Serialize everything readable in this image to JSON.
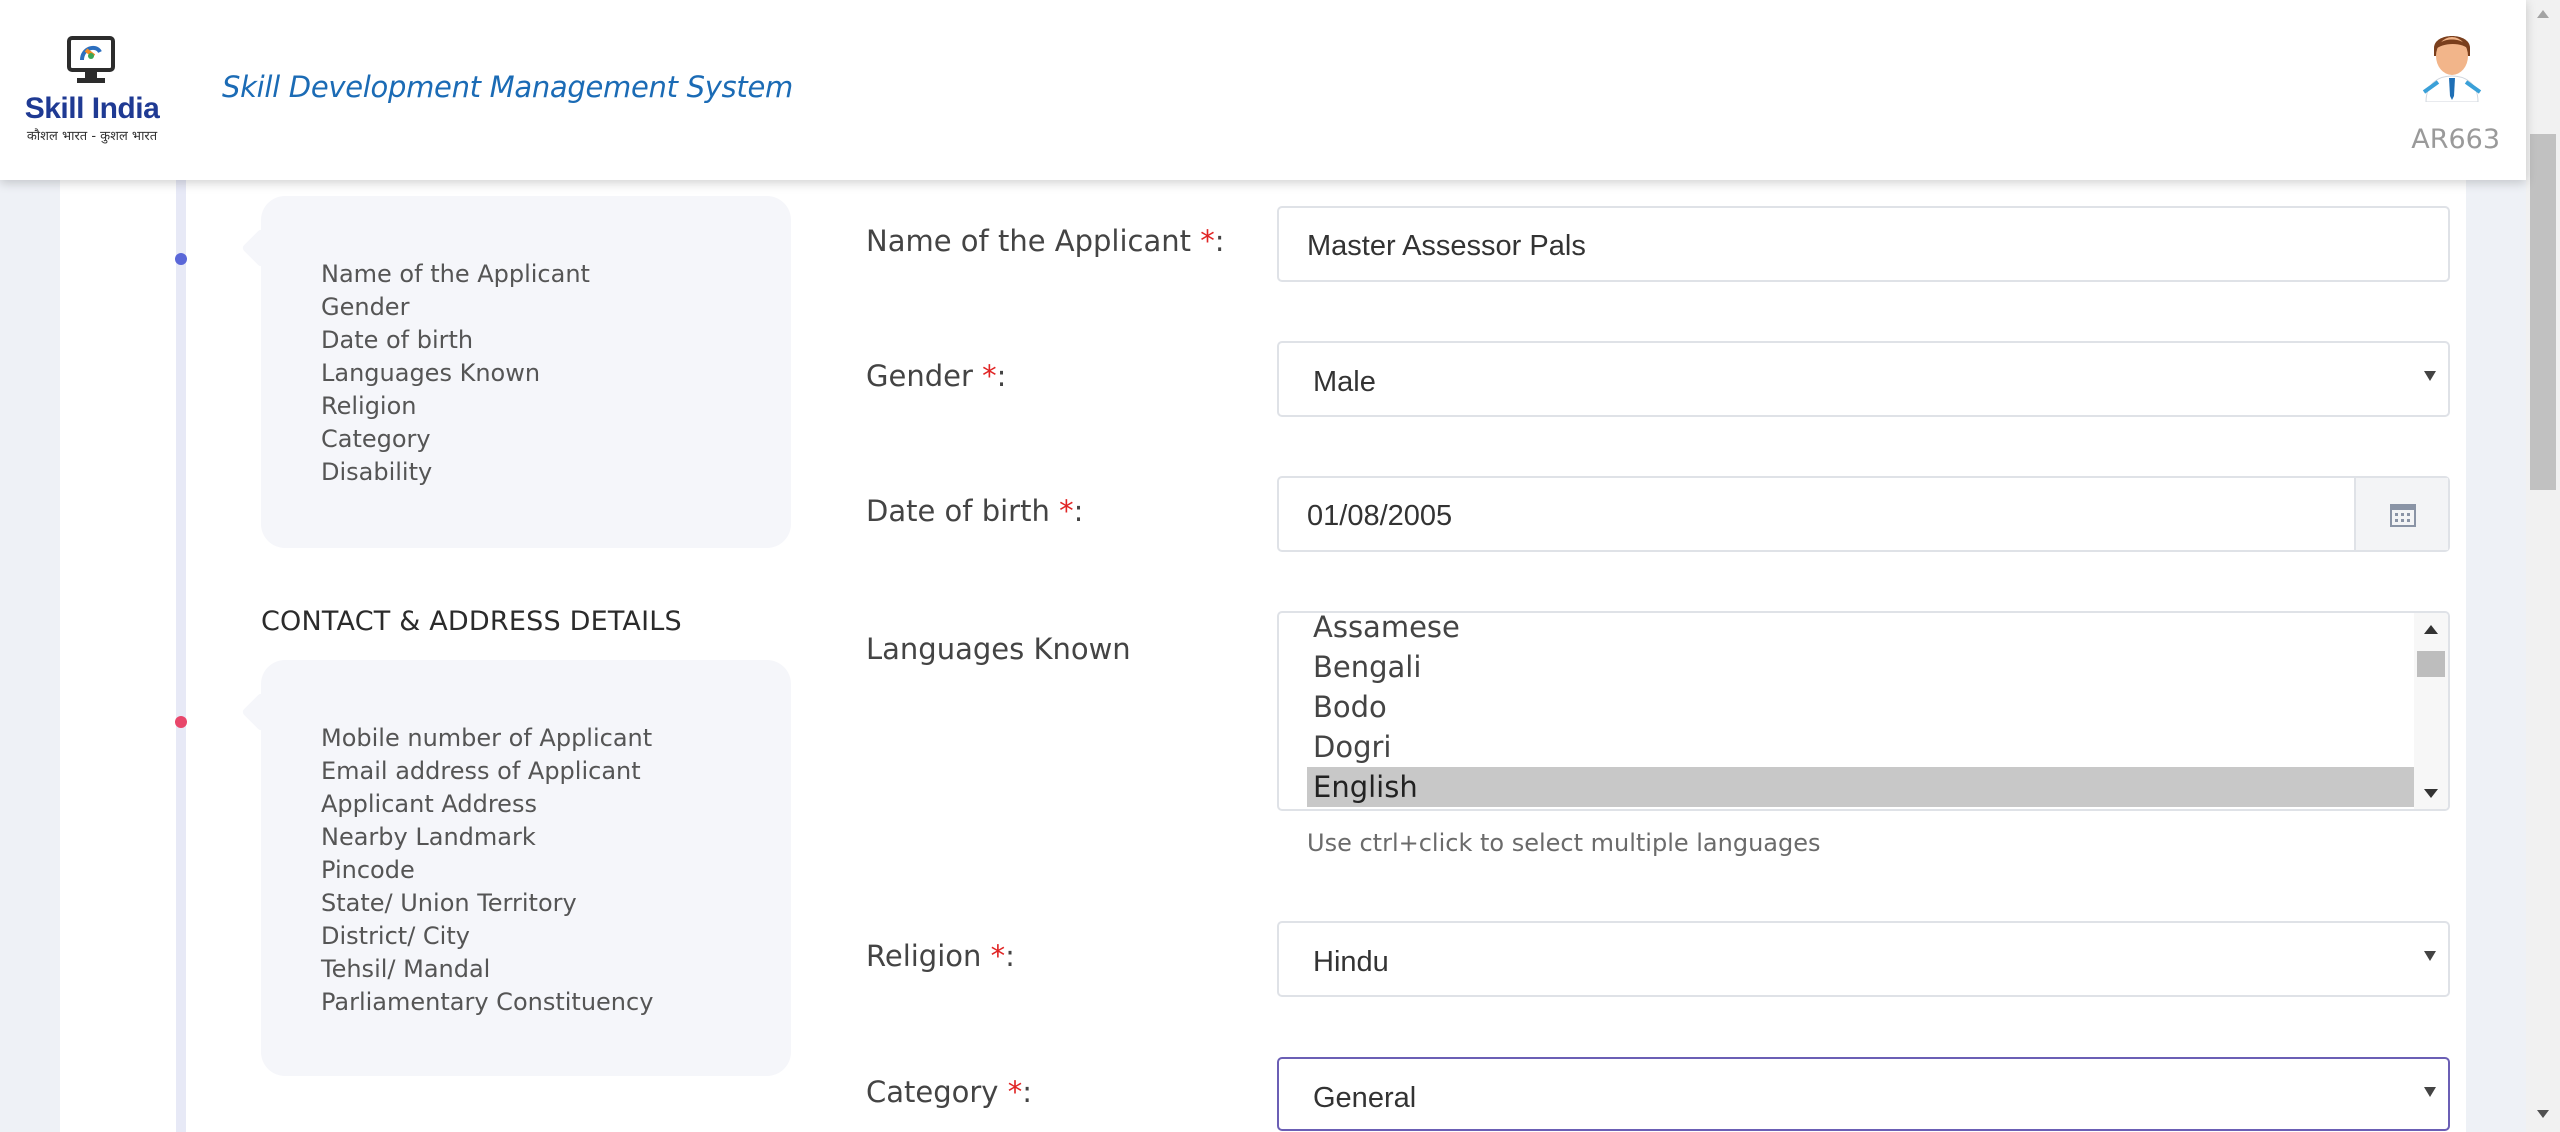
{
  "header": {
    "brand": "Skill India",
    "tagline": "कौशल भारत - कुशल भारत",
    "app_title": "Skill Development Management System",
    "user_id": "AR663",
    "logo_icon": "skill-india-logo",
    "avatar_icon": "user-avatar-icon"
  },
  "sidebar": {
    "personal_items": [
      "Name of the Applicant",
      "Gender",
      "Date of birth",
      "Languages Known",
      "Religion",
      "Category",
      "Disability"
    ],
    "contact_heading": "CONTACT & ADDRESS DETAILS",
    "contact_items": [
      "Mobile number of Applicant",
      "Email address of Applicant",
      "Applicant Address",
      "Nearby Landmark",
      "Pincode",
      "State/ Union Territory",
      "District/ City",
      "Tehsil/ Mandal",
      "Parliamentary Constituency"
    ],
    "dot_colors": [
      "#5a67d8",
      "#e8466a"
    ]
  },
  "form": {
    "required_mark": "*",
    "name": {
      "label": "Name of the Applicant ",
      "suffix": ":",
      "value": "Master Assessor Pals"
    },
    "gender": {
      "label": "Gender ",
      "suffix": ":",
      "value": "Male"
    },
    "dob": {
      "label": "Date of birth ",
      "suffix": ":",
      "value": "01/08/2005",
      "icon": "calendar-icon"
    },
    "languages": {
      "label": "Languages Known",
      "options": [
        "Assamese",
        "Bengali",
        "Bodo",
        "Dogri",
        "English"
      ],
      "selected": "English",
      "help": "Use ctrl+click to select multiple languages"
    },
    "religion": {
      "label": "Religion ",
      "suffix": ":",
      "value": "Hindu"
    },
    "category": {
      "label": "Category ",
      "suffix": ":",
      "value": "General"
    }
  },
  "colors": {
    "accent": "#1b6bb5",
    "required": "#e02424",
    "active_border": "#6b5fb5"
  }
}
